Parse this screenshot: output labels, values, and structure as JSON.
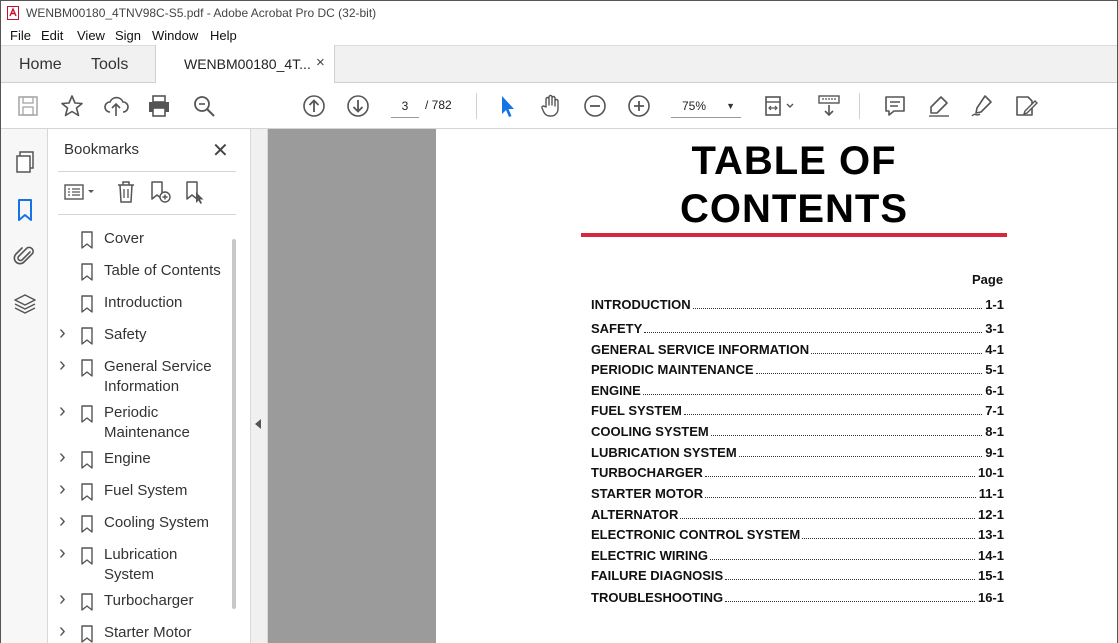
{
  "window": {
    "title": "WENBM00180_4TNV98C-S5.pdf - Adobe Acrobat Pro DC (32-bit)"
  },
  "menu": [
    "File",
    "Edit",
    "View",
    "Sign",
    "Window",
    "Help"
  ],
  "tabs": {
    "home": "Home",
    "tools": "Tools",
    "document": "WENBM00180_4T...",
    "close": "×"
  },
  "toolbar": {
    "icons": [
      "save-icon",
      "star-icon",
      "upload-icon",
      "print-icon",
      "zoom-search-icon",
      "page-up-icon",
      "page-down-icon",
      "select-cursor-icon",
      "hand-icon",
      "zoom-out-icon",
      "zoom-in-icon",
      "page-fit-icon",
      "scroll-mode-icon",
      "comment-icon",
      "highlight-icon",
      "sign-icon",
      "edit-pdf-icon"
    ],
    "page_current": "3",
    "page_total": "/ 782",
    "zoom": "75%"
  },
  "bookmarks": {
    "header": "Bookmarks",
    "close": "✕",
    "items": [
      {
        "label": "Cover",
        "expandable": false
      },
      {
        "label": "Table of Contents",
        "expandable": false
      },
      {
        "label": "Introduction",
        "expandable": false
      },
      {
        "label": "Safety",
        "expandable": true
      },
      {
        "label": "General Service Information",
        "expandable": true
      },
      {
        "label": "Periodic Maintenance",
        "expandable": true
      },
      {
        "label": "Engine",
        "expandable": true
      },
      {
        "label": "Fuel System",
        "expandable": true
      },
      {
        "label": "Cooling System",
        "expandable": true
      },
      {
        "label": "Lubrication System",
        "expandable": true
      },
      {
        "label": "Turbocharger",
        "expandable": true
      },
      {
        "label": "Starter Motor",
        "expandable": true
      }
    ]
  },
  "document": {
    "title_line1": "TABLE OF",
    "title_line2": "CONTENTS",
    "page_header": "Page",
    "accent_color": "#d7263d",
    "toc": [
      {
        "name": "INTRODUCTION",
        "page": "1-1"
      },
      {
        "name": "SAFETY",
        "page": "3-1"
      },
      {
        "name": "GENERAL SERVICE INFORMATION",
        "page": "4-1"
      },
      {
        "name": "PERIODIC MAINTENANCE",
        "page": "5-1"
      },
      {
        "name": "ENGINE",
        "page": "6-1"
      },
      {
        "name": "FUEL SYSTEM",
        "page": "7-1"
      },
      {
        "name": "COOLING SYSTEM",
        "page": "8-1"
      },
      {
        "name": "LUBRICATION SYSTEM",
        "page": "9-1"
      },
      {
        "name": "TURBOCHARGER",
        "page": "10-1"
      },
      {
        "name": "STARTER MOTOR",
        "page": "11-1"
      },
      {
        "name": "ALTERNATOR",
        "page": "12-1"
      },
      {
        "name": "ELECTRONIC CONTROL SYSTEM",
        "page": "13-1"
      },
      {
        "name": "ELECTRIC WIRING",
        "page": "14-1"
      },
      {
        "name": "FAILURE DIAGNOSIS",
        "page": "15-1"
      },
      {
        "name": "TROUBLESHOOTING",
        "page": "16-1"
      }
    ]
  }
}
